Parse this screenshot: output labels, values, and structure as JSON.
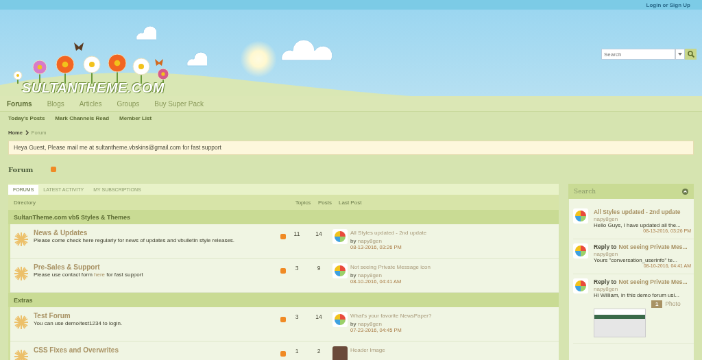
{
  "top_bar": {
    "login": "Login or Sign Up"
  },
  "header": {
    "logo": "SULTANTHEME.COM",
    "search": {
      "placeholder": "Search"
    }
  },
  "nav": [
    {
      "label": "Forums",
      "selected": true
    },
    {
      "label": "Blogs",
      "selected": false
    },
    {
      "label": "Articles",
      "selected": false
    },
    {
      "label": "Groups",
      "selected": false
    },
    {
      "label": "Buy Super Pack",
      "selected": false
    }
  ],
  "subnav": [
    "Today's Posts",
    "Mark Channels Read",
    "Member List"
  ],
  "breadcrumb": [
    {
      "label": "Home",
      "selected": false
    },
    {
      "label": "Forum",
      "selected": true
    }
  ],
  "notice": "Heya Guest, Please mail me at sultantheme.vbskins@gmail.com for fast support",
  "page_title": "Forum",
  "tabs": [
    {
      "label": "FORUMS",
      "selected": true
    },
    {
      "label": "LATEST ACTIVITY",
      "selected": false
    },
    {
      "label": "MY SUBSCRIPTIONS",
      "selected": false
    }
  ],
  "table": {
    "columns": [
      "Directory",
      "Topics",
      "Posts",
      "Last Post"
    ],
    "sections": [
      {
        "title": "SultanTheme.com vb5 Styles & Themes",
        "forums": [
          {
            "name": "News & Updates",
            "description": "Please come check here regularly for news of updates and vbulletin style releases.",
            "topics": "11",
            "posts": "14",
            "last_post": {
              "kind": "logo",
              "title": "All Styles updated - 2nd update",
              "by": "by",
              "user": "napy8gen",
              "date": "08-13-2016, 03:26 PM"
            }
          },
          {
            "name": "Pre-Sales & Support",
            "description": "Please use contact form ",
            "link": "here",
            "description_after": " for fast support",
            "topics": "3",
            "posts": "9",
            "last_post": {
              "kind": "logo",
              "title": "Not seeing Private Message icon",
              "by": "by",
              "user": "napy8gen",
              "date": "08-10-2016, 04:41 AM"
            }
          }
        ]
      },
      {
        "title": "Extras",
        "forums": [
          {
            "name": "Test Forum",
            "description": "You can use demo/test1234 to login.",
            "topics": "3",
            "posts": "14",
            "last_post": {
              "kind": "logo",
              "title": "What's your favorite NewsPaper?",
              "by": "by",
              "user": "napy8gen",
              "date": "07-23-2016, 04:45 PM"
            }
          },
          {
            "name": "CSS Fixes and Overwrites",
            "topics": "1",
            "posts": "2",
            "last_post": {
              "kind": "photo",
              "title": "Header Image"
            }
          }
        ]
      }
    ]
  },
  "sidebar": {
    "title": "Search",
    "items": [
      {
        "kind": "topic",
        "title": "All Styles updated - 2nd update",
        "user": "napy8gen",
        "excerpt": "Hello Guys, I have updated all the...",
        "date": "08-13-2016, 03:26 PM"
      },
      {
        "kind": "reply",
        "prefix": "Reply to",
        "title": "Not seeing Private Mes...",
        "user": "napy8gen",
        "excerpt": "Yours \"conversation_userinfo\" te...",
        "date": "08-10-2016, 04:41 AM"
      },
      {
        "kind": "reply",
        "prefix": "Reply to",
        "title": "Not seeing Private Mes...",
        "user": "napy8gen",
        "excerpt": "Hi William, in this demo forum usi...",
        "photo_count": "1",
        "photo_label": "Photo"
      }
    ]
  }
}
